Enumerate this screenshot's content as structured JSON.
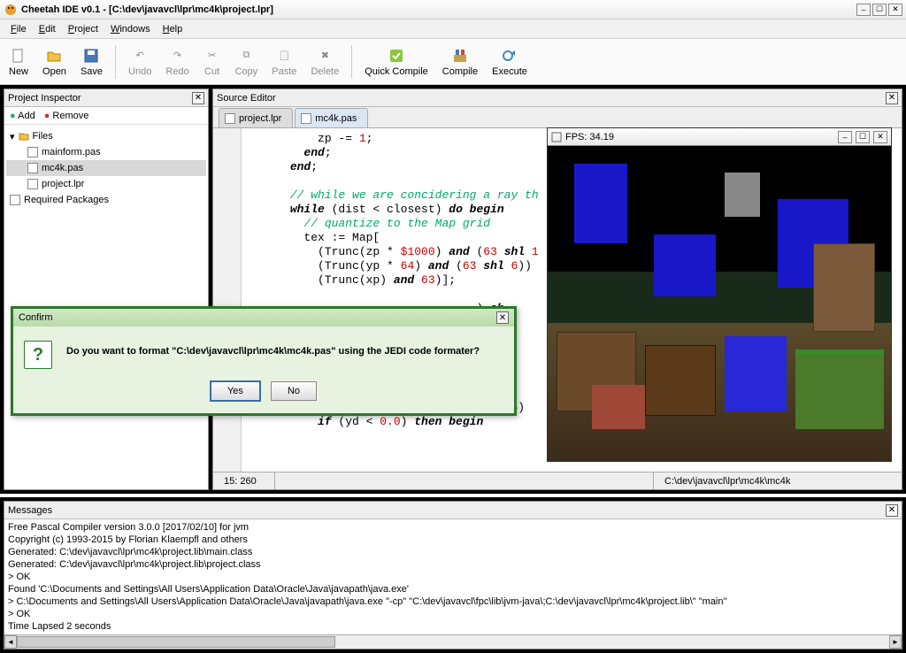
{
  "window": {
    "title": "Cheetah IDE v0.1 - [C:\\dev\\javavcl\\lpr\\mc4k\\project.lpr]"
  },
  "menu": {
    "file": "File",
    "edit": "Edit",
    "project": "Project",
    "windows": "Windows",
    "help": "Help"
  },
  "toolbar": {
    "new": "New",
    "open": "Open",
    "save": "Save",
    "undo": "Undo",
    "redo": "Redo",
    "cut": "Cut",
    "copy": "Copy",
    "paste": "Paste",
    "delete": "Delete",
    "quick": "Quick Compile",
    "compile": "Compile",
    "execute": "Execute"
  },
  "inspector": {
    "title": "Project Inspector",
    "add": "Add",
    "remove": "Remove",
    "root": "Files",
    "files": [
      "mainform.pas",
      "mc4k.pas",
      "project.lpr"
    ],
    "required": "Required Packages"
  },
  "editor": {
    "title": "Source Editor",
    "tabs": [
      "project.lpr",
      "mc4k.pas"
    ],
    "active": 1,
    "status": {
      "pos": "15: 260",
      "path": "C:\\dev\\javavcl\\lpr\\mc4k\\mc4k"
    }
  },
  "fps": {
    "title": "FPS: 34.19"
  },
  "dialog": {
    "title": "Confirm",
    "message": "Do you want to format \"C:\\dev\\javavcl\\lpr\\mc4k\\mc4k.pas\" using the JEDI code formater?",
    "yes": "Yes",
    "no": "No"
  },
  "messages": {
    "title": "Messages",
    "lines": [
      "Free Pascal Compiler version 3.0.0 [2017/02/10] for jvm",
      "Copyright (c) 1993-2015 by Florian Klaempfl and others",
      "Generated: C:\\dev\\javavcl\\lpr\\mc4k\\project.lib\\main.class",
      "Generated: C:\\dev\\javavcl\\lpr\\mc4k\\project.lib\\project.class",
      "> OK",
      "Found 'C:\\Documents and Settings\\All Users\\Application Data\\Oracle\\Java\\javapath\\java.exe'",
      "> C:\\Documents and Settings\\All Users\\Application Data\\Oracle\\Java\\javapath\\java.exe  \"-cp\"  \"C:\\dev\\javavcl\\fpc\\lib\\jvm-java\\;C:\\dev\\javavcl\\lpr\\mc4k\\project.lib\\\"  \"main\"",
      "> OK",
      "Time Lapsed 2 seconds"
    ]
  }
}
